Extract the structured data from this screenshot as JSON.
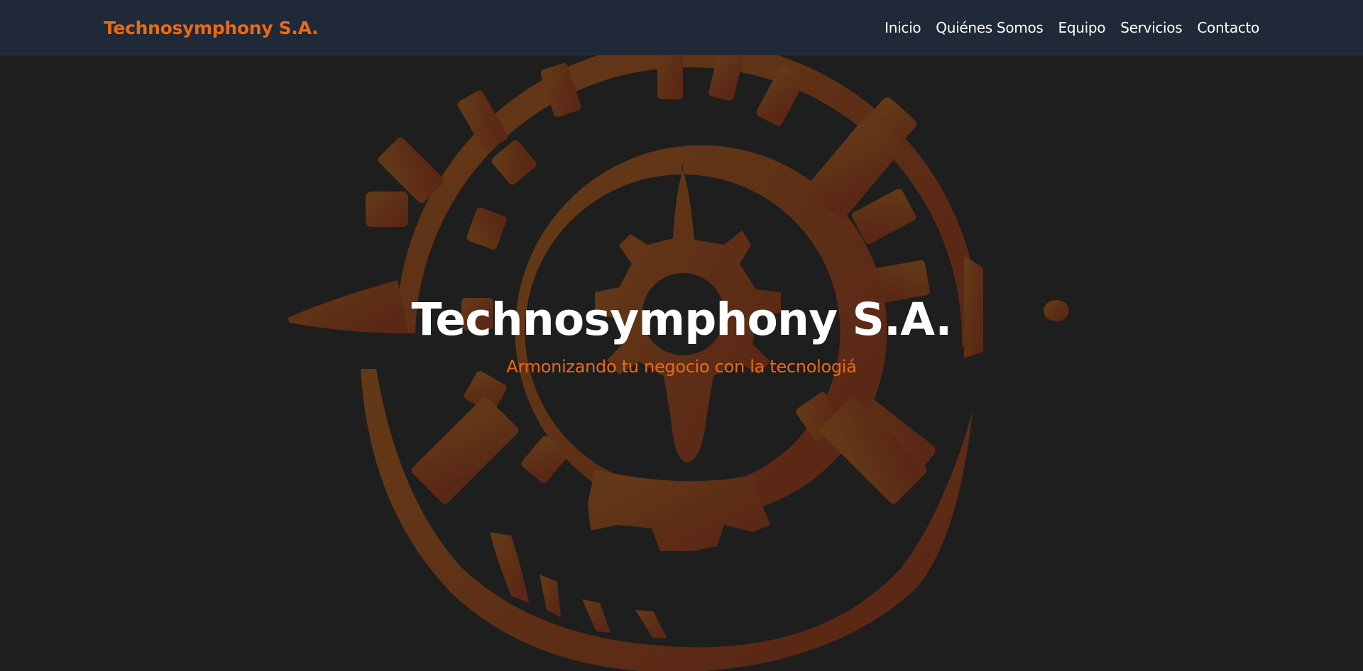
{
  "header": {
    "brand": "Technosymphony S.A.",
    "nav": [
      {
        "label": "Inicio"
      },
      {
        "label": "Quiénes Somos"
      },
      {
        "label": "Equipo"
      },
      {
        "label": "Servicios"
      },
      {
        "label": "Contacto"
      }
    ]
  },
  "hero": {
    "title": "Technosymphony S.A.",
    "subtitle": "Armonizando tu negocio con la tecnologiá",
    "background_logo_icon": "gears-logo-icon"
  },
  "colors": {
    "navbar_bg": "#1f2937",
    "page_bg": "#1e1e1e",
    "accent": "#ea6a12",
    "logo_rust": "#5c2816",
    "logo_brown": "#633817",
    "text_light": "#ffffff"
  }
}
